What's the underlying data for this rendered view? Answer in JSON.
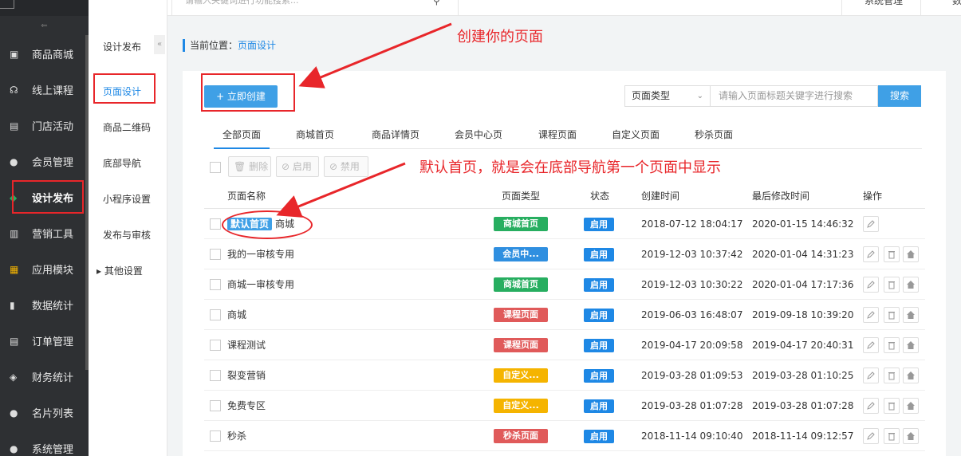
{
  "topbar": {
    "search_placeholder": "请输入关键词进行功能搜索...",
    "sys_label": "系统管理",
    "extra_label": "数"
  },
  "sidebar": {
    "items": [
      {
        "label": "商品商城",
        "icon": "shop-icon"
      },
      {
        "label": "线上课程",
        "icon": "course-icon"
      },
      {
        "label": "门店活动",
        "icon": "store-icon"
      },
      {
        "label": "会员管理",
        "icon": "member-icon"
      },
      {
        "label": "设计发布",
        "icon": "design-icon"
      },
      {
        "label": "营销工具",
        "icon": "gift-icon"
      },
      {
        "label": "应用模块",
        "icon": "apps-icon"
      },
      {
        "label": "数据统计",
        "icon": "chart-icon"
      },
      {
        "label": "订单管理",
        "icon": "order-icon"
      },
      {
        "label": "财务统计",
        "icon": "finance-icon"
      },
      {
        "label": "名片列表",
        "icon": "card-icon"
      },
      {
        "label": "系统管理",
        "icon": "system-icon"
      }
    ]
  },
  "subnav": {
    "title": "设计发布",
    "items": [
      "页面设计",
      "商品二维码",
      "底部导航",
      "小程序设置",
      "发布与审核",
      "其他设置"
    ]
  },
  "breadcrumb": {
    "prefix": "当前位置：",
    "current": "页面设计"
  },
  "actions": {
    "create_label": "+ 立即创建",
    "type_select": "页面类型",
    "search_placeholder": "请输入页面标题关键字进行搜索",
    "search_button": "搜索",
    "delete": "删除",
    "enable": "启用",
    "disable": "禁用"
  },
  "tabs": [
    "全部页面",
    "商城首页",
    "商品详情页",
    "会员中心页",
    "课程页面",
    "自定义页面",
    "秒杀页面"
  ],
  "table": {
    "headers": [
      "页面名称",
      "页面类型",
      "状态",
      "创建时间",
      "最后修改时间",
      "操作"
    ],
    "rows": [
      {
        "badge": "默认首页",
        "name": "商城",
        "type": "商城首页",
        "type_color": "#27ae60",
        "status": "启用",
        "created": "2018-07-12 18:04:17",
        "modified": "2020-01-15 14:46:32"
      },
      {
        "badge": "",
        "name": "我的一审核专用",
        "type": "会员中...",
        "type_color": "#2f8fe0",
        "status": "启用",
        "created": "2019-12-03 10:37:42",
        "modified": "2020-01-04 14:31:23"
      },
      {
        "badge": "",
        "name": "商城一审核专用",
        "type": "商城首页",
        "type_color": "#27ae60",
        "status": "启用",
        "created": "2019-12-03 10:30:22",
        "modified": "2020-01-04 17:17:36"
      },
      {
        "badge": "",
        "name": "商城",
        "type": "课程页面",
        "type_color": "#e05a5a",
        "status": "启用",
        "created": "2019-06-03 16:48:07",
        "modified": "2019-09-18 10:39:20"
      },
      {
        "badge": "",
        "name": "课程测试",
        "type": "课程页面",
        "type_color": "#e05a5a",
        "status": "启用",
        "created": "2019-04-17 20:09:58",
        "modified": "2019-04-17 20:40:31"
      },
      {
        "badge": "",
        "name": "裂变营销",
        "type": "自定义...",
        "type_color": "#f5b400",
        "status": "启用",
        "created": "2019-03-28 01:09:53",
        "modified": "2019-03-28 01:10:25"
      },
      {
        "badge": "",
        "name": "免费专区",
        "type": "自定义...",
        "type_color": "#f5b400",
        "status": "启用",
        "created": "2019-03-28 01:07:28",
        "modified": "2019-03-28 01:07:28"
      },
      {
        "badge": "",
        "name": "秒杀",
        "type": "秒杀页面",
        "type_color": "#e05a5a",
        "status": "启用",
        "created": "2018-11-14 09:10:40",
        "modified": "2018-11-14 09:12:57"
      }
    ]
  },
  "annotations": {
    "create": "创建你的页面",
    "default": "默认首页，就是会在底部导航第一个页面中显示"
  },
  "colors": {
    "accent": "#1e88e5",
    "highlight": "#e8262a",
    "sidebar_bg": "#2e3033"
  }
}
